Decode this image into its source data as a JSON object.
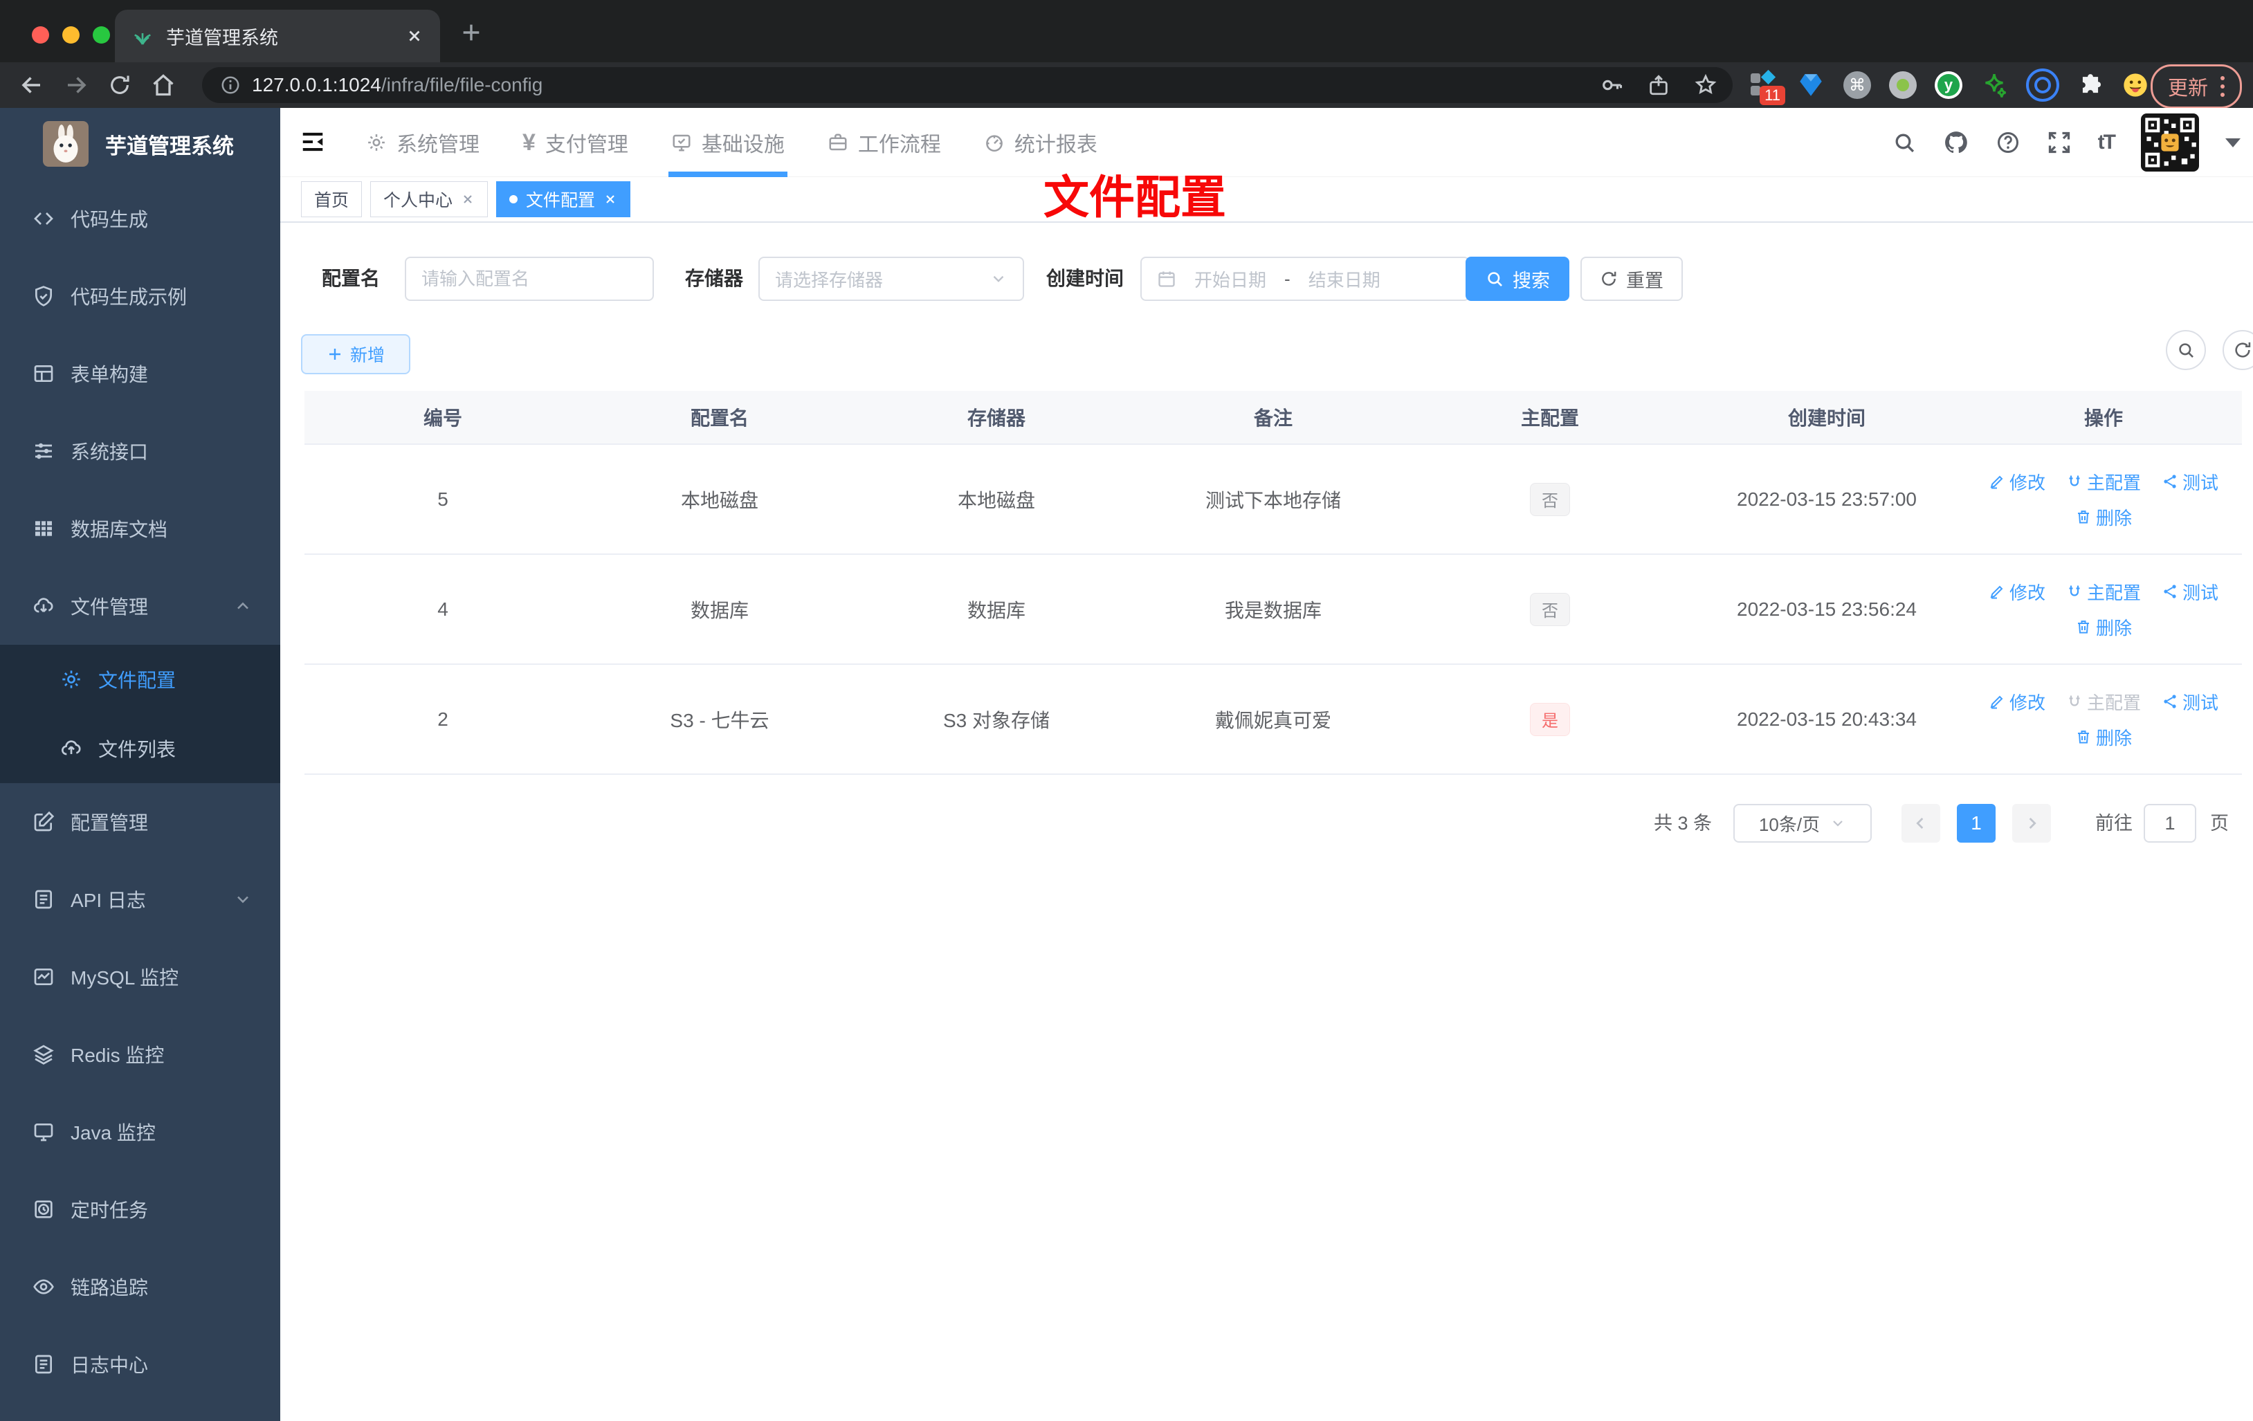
{
  "colors": {
    "accent": "#409eff",
    "danger_tag_text": "#f56c6c",
    "info_tag_text": "#909399",
    "sidebar_bg": "#304156",
    "submenu_bg": "#1f2d3d",
    "overlay_red": "#f70808",
    "active_page_bg": "#409eff"
  },
  "icons": {
    "yen": "¥",
    "font_size": "tT",
    "command": "⌘",
    "y_logo": "y"
  },
  "browser": {
    "tab_title": "芋道管理系统",
    "url_host": "127.0.0.1:1024",
    "url_path": "/infra/file/file-config",
    "ext_badge": "11",
    "update_label": "更新"
  },
  "sidebar": {
    "logo_title": "芋道管理系统",
    "items": [
      {
        "label": "代码生成"
      },
      {
        "label": "代码生成示例"
      },
      {
        "label": "表单构建"
      },
      {
        "label": "系统接口"
      },
      {
        "label": "数据库文档"
      },
      {
        "label": "文件管理"
      },
      {
        "label": "配置管理"
      },
      {
        "label": "API 日志"
      },
      {
        "label": "MySQL 监控"
      },
      {
        "label": "Redis 监控"
      },
      {
        "label": "Java 监控"
      },
      {
        "label": "定时任务"
      },
      {
        "label": "链路追踪"
      },
      {
        "label": "日志中心"
      }
    ],
    "submenu": [
      {
        "label": "文件配置",
        "active": true
      },
      {
        "label": "文件列表",
        "active": false
      }
    ]
  },
  "header": {
    "nav": [
      {
        "label": "系统管理"
      },
      {
        "label": "支付管理"
      },
      {
        "label": "基础设施",
        "active": true
      },
      {
        "label": "工作流程"
      },
      {
        "label": "统计报表"
      }
    ]
  },
  "tabsbar": {
    "tabs": [
      {
        "label": "首页",
        "closable": false,
        "active": false
      },
      {
        "label": "个人中心",
        "closable": true,
        "active": false
      },
      {
        "label": "文件配置",
        "closable": true,
        "active": true
      }
    ]
  },
  "overlay": {
    "title": "文件配置"
  },
  "filter": {
    "config_name_label": "配置名",
    "config_name_placeholder": "请输入配置名",
    "storage_label": "存储器",
    "storage_placeholder": "请选择存储器",
    "create_time_label": "创建时间",
    "date_start_placeholder": "开始日期",
    "date_separator": "-",
    "date_end_placeholder": "结束日期",
    "search_label": "搜索",
    "reset_label": "重置"
  },
  "toolbar": {
    "add_label": "新增"
  },
  "table": {
    "columns": [
      "编号",
      "配置名",
      "存储器",
      "备注",
      "主配置",
      "创建时间",
      "操作"
    ],
    "action_labels": {
      "edit": "修改",
      "master": "主配置",
      "test": "测试",
      "delete": "删除"
    },
    "rows": [
      {
        "id": "5",
        "name": "本地磁盘",
        "storage": "本地磁盘",
        "remark": "测试下本地存储",
        "master_tag": "否",
        "tag_type": "info",
        "created": "2022-03-15 23:57:00",
        "master_disabled": false
      },
      {
        "id": "4",
        "name": "数据库",
        "storage": "数据库",
        "remark": "我是数据库",
        "master_tag": "否",
        "tag_type": "info",
        "created": "2022-03-15 23:56:24",
        "master_disabled": false
      },
      {
        "id": "2",
        "name": "S3 - 七牛云",
        "storage": "S3 对象存储",
        "remark": "戴佩妮真可爱",
        "master_tag": "是",
        "tag_type": "danger",
        "created": "2022-03-15 20:43:34",
        "master_disabled": true
      }
    ]
  },
  "pagination": {
    "total_label": "共 3 条",
    "page_size": "10条/页",
    "current_page": "1",
    "goto_label": "前往",
    "goto_value": "1",
    "page_unit": "页"
  }
}
